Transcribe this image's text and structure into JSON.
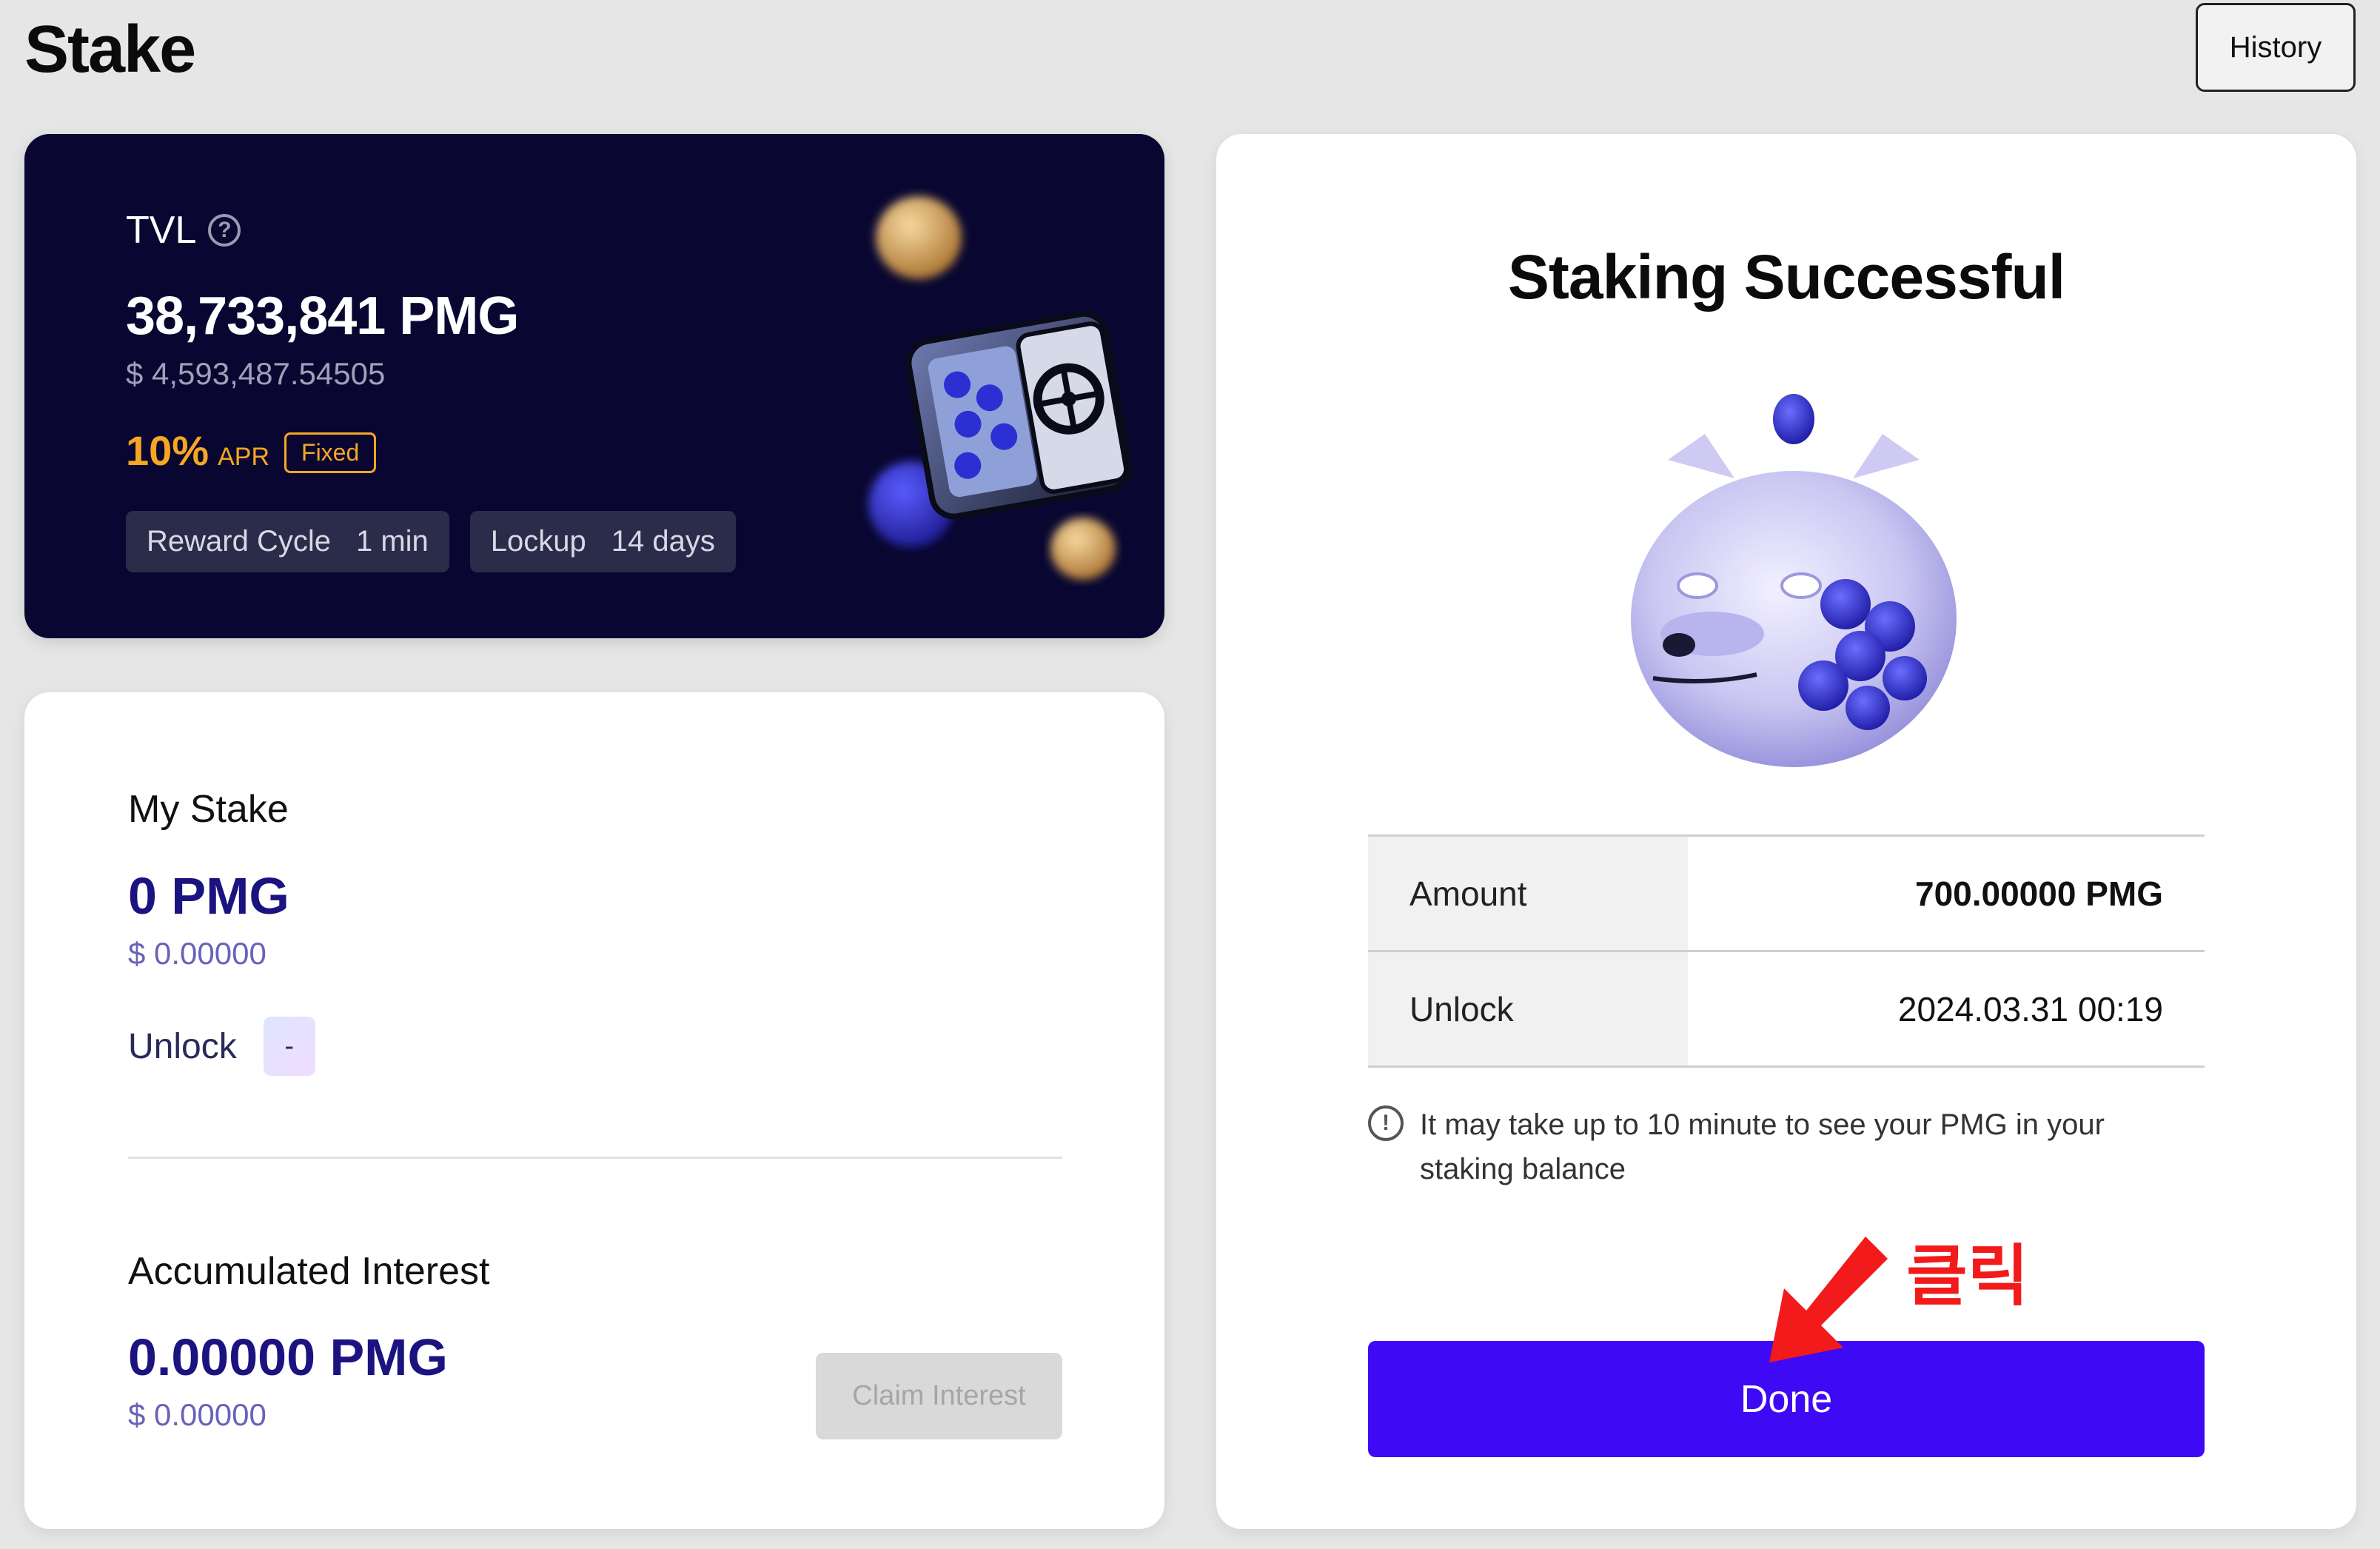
{
  "header": {
    "title": "Stake",
    "history_label": "History"
  },
  "tvl": {
    "label": "TVL",
    "value": "38,733,841 PMG",
    "usd": "$ 4,593,487.54505",
    "apr_value": "10%",
    "apr_label": "APR",
    "apr_badge": "Fixed",
    "reward_cycle_label": "Reward Cycle",
    "reward_cycle_value": "1 min",
    "lockup_label": "Lockup",
    "lockup_value": "14 days"
  },
  "my_stake": {
    "title": "My Stake",
    "value": "0 PMG",
    "usd": "$ 0.00000",
    "unlock_label": "Unlock",
    "unlock_value": "-",
    "interest_title": "Accumulated Interest",
    "interest_value": "0.00000 PMG",
    "interest_usd": "$ 0.00000",
    "claim_label": "Claim Interest"
  },
  "success": {
    "title": "Staking Successful",
    "rows": [
      {
        "key": "Amount",
        "value": "700.00000 PMG"
      },
      {
        "key": "Unlock",
        "value": "2024.03.31 00:19"
      }
    ],
    "notice": "It may take up to 10 minute to see your PMG in your staking balance",
    "done_label": "Done"
  },
  "annotation": {
    "text": "클릭",
    "color": "#f21a1a"
  },
  "colors": {
    "accent": "#3e0af5",
    "tvl_bg": "#090731",
    "apr": "#f5a623",
    "stake_value": "#1a1380"
  },
  "icons": [
    "help-icon",
    "vault-illustration",
    "piggy-dog-illustration",
    "info-icon",
    "red-arrow-annotation"
  ]
}
